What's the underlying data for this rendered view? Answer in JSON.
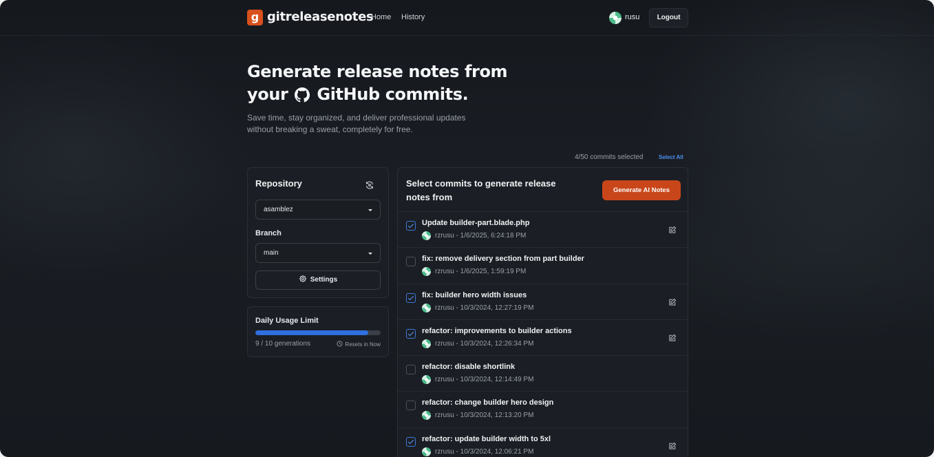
{
  "header": {
    "logo_letter": "g",
    "brand": "gitreleasenotes",
    "nav": [
      {
        "label": "Home"
      },
      {
        "label": "History"
      }
    ],
    "username": "rusu",
    "logout_label": "Logout"
  },
  "hero": {
    "title_line1": "Generate release notes from",
    "title_line2_pre": "your",
    "title_line2_post": "GitHub commits.",
    "subtitle": "Save time, stay organized, and deliver professional updates without breaking a sweat, completely for free."
  },
  "selection": {
    "count_text": "4/50 commits selected",
    "select_all_label": "Select All"
  },
  "repository_card": {
    "title": "Repository",
    "repo_value": "asamblez",
    "branch_label": "Branch",
    "branch_value": "main",
    "settings_label": "Settings"
  },
  "usage": {
    "title": "Daily Usage Limit",
    "used": 9,
    "limit": 10,
    "count_text": "9 / 10 generations",
    "reset_text": "Resets in Now"
  },
  "commits_panel": {
    "title": "Select commits to generate release notes from",
    "generate_label": "Generate AI Notes",
    "commits": [
      {
        "message": "Update builder-part.blade.php",
        "meta": "rzrusu - 1/6/2025, 6:24:18 PM",
        "checked": true
      },
      {
        "message": "fix: remove delivery section from part builder",
        "meta": "rzrusu - 1/6/2025, 1:59:19 PM",
        "checked": false
      },
      {
        "message": "fix: builder hero width issues",
        "meta": "rzrusu - 10/3/2024, 12:27:19 PM",
        "checked": true
      },
      {
        "message": "refactor: improvements to builder actions",
        "meta": "rzrusu - 10/3/2024, 12:26:34 PM",
        "checked": true
      },
      {
        "message": "refactor: disable shortlink",
        "meta": "rzrusu - 10/3/2024, 12:14:49 PM",
        "checked": false
      },
      {
        "message": "refactor: change builder hero design",
        "meta": "rzrusu - 10/3/2024, 12:13:20 PM",
        "checked": false
      },
      {
        "message": "refactor: update builder width to 5xl",
        "meta": "rzrusu - 10/3/2024, 12:06:21 PM",
        "checked": true
      }
    ]
  },
  "colors": {
    "accent": "#d8501d",
    "button": "#c9461a",
    "progress": "#2f6fe0",
    "link": "#4d8ff0"
  }
}
